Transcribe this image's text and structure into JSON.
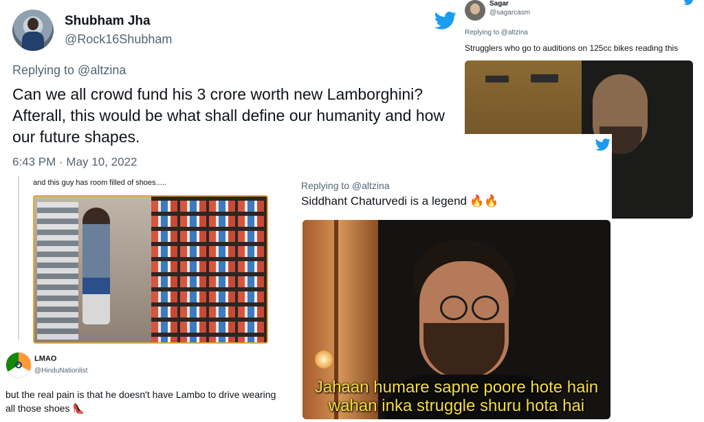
{
  "colors": {
    "twitter_blue": "#1d9bf0",
    "muted": "#536471",
    "text": "#0f1419",
    "caption_yellow": "#f7de3b"
  },
  "tweets": {
    "main": {
      "name": "Shubham Jha",
      "handle": "@Rock16Shubham",
      "replying_to": "Replying to @altzina",
      "text": "Can we all crowd fund his 3 crore worth new Lamborghini? Afterall, this would be what shall define our humanity and how our future shapes.",
      "timestamp": "6:43 PM · May 10, 2022",
      "info_icon_glyph": "i"
    },
    "sagar": {
      "name": "Sagar",
      "handle": "@sagarcasm",
      "replying_to": "Replying to @altzina",
      "text": "Strugglers who go to auditions on 125cc bikes reading this"
    },
    "siddhant": {
      "replying_to": "Replying to @altzina",
      "text": "Siddhant Chaturvedi is a legend",
      "emoji": "🔥🔥",
      "meme_caption_line1": "Jahaan humare sapne poore hote hain",
      "meme_caption_line2": "wahan inka struggle shuru hota hai"
    },
    "shoes": {
      "text": "and this guy has room filled of shoes....."
    },
    "lmao": {
      "name": "LMAO",
      "handle": "@HinduNationlist",
      "text": "but the real pain is that he doesn't have Lambo to drive wearing all those shoes",
      "emoji": "👠"
    }
  }
}
